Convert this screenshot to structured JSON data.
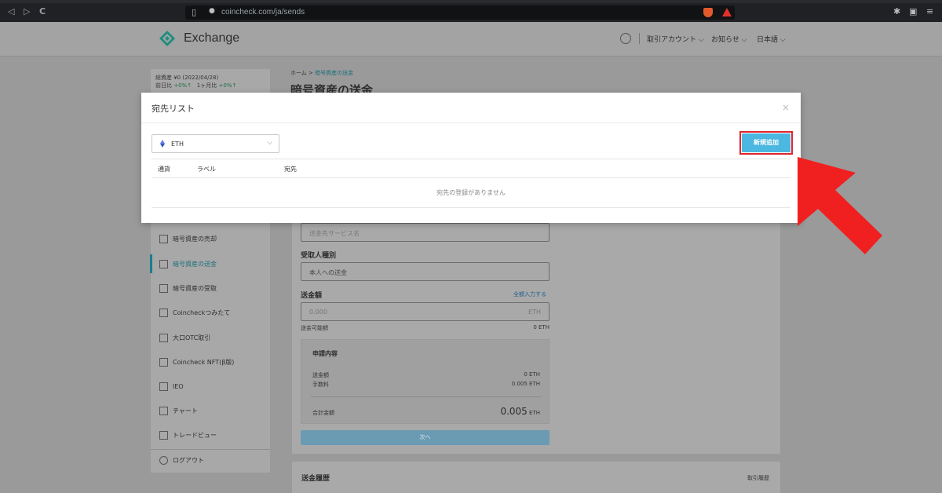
{
  "browser": {
    "url": "coincheck.com/ja/sends",
    "nav_back": "◁",
    "nav_forward": "▷",
    "nav_reload": "C"
  },
  "header": {
    "logo_text": "Exchange",
    "account_menu": "取引アカウント ⌵",
    "news_menu": "お知らせ ⌵",
    "language_menu": "日本語 ⌵"
  },
  "sidebar": {
    "balance_line1": "総資産 ¥0",
    "balance_line1_note": "(2022/04/28)",
    "balance_line2_label": "前日比",
    "balance_line2_value": "+0%↑",
    "balance_line2b_label": "1ヶ月比",
    "balance_line2b_value": "+0%↑",
    "items": [
      {
        "label": "暗号資産の売却",
        "top": 0
      },
      {
        "label": "暗号資産の送金"
      },
      {
        "label": "暗号資産の受取"
      },
      {
        "label": "Coincheckつみたて"
      },
      {
        "label": "大口OTC取引"
      },
      {
        "label": "Coincheck NFT(β版)"
      },
      {
        "label": "IEO"
      },
      {
        "label": "チャート"
      },
      {
        "label": "トレードビュー"
      },
      {
        "label": "ログアウト"
      }
    ]
  },
  "page": {
    "breadcrumb_home": "ホーム >",
    "breadcrumb_current": "暗号資産の送金",
    "title": "暗号資産の送金",
    "service_placeholder": "送金先サービス名",
    "recipient_type_label": "受取人種別",
    "recipient_type_value": "本人への送金",
    "amount_label": "送金額",
    "amount_all_link": "全額入力する",
    "amount_placeholder": "0.000",
    "amount_unit": "ETH",
    "available_label": "送金可能額",
    "available_value": "0 ETH",
    "summary_title": "申請内容",
    "summary_amount_label": "送金額",
    "summary_amount_value": "0 ETH",
    "summary_fee_label": "手数料",
    "summary_fee_value": "0.005 ETH",
    "summary_total_label": "合計金額",
    "summary_total_value": "0.005",
    "summary_total_unit": "ETH",
    "next_button": "次へ",
    "history_title": "送金履歴",
    "history_link": "取引履歴"
  },
  "modal": {
    "title": "宛先リスト",
    "close": "×",
    "currency_value": "ETH",
    "add_button": "新規追加",
    "col_currency": "通貨",
    "col_label": "ラベル",
    "col_address": "宛先",
    "empty_message": "宛先の登録がありません"
  },
  "colors": {
    "accent_button": "#4cb7e0",
    "highlight_red": "#e0242e",
    "annotation_arrow": "#f02020",
    "brand_teal": "#1a7f8c"
  }
}
